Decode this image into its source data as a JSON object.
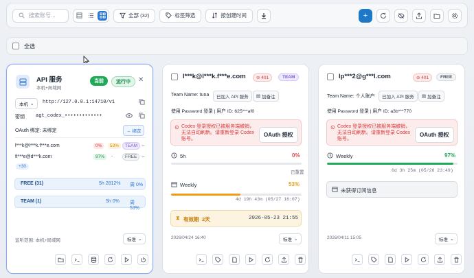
{
  "toolbar": {
    "search_placeholder": "搜索账号...",
    "filter_all": "全部 (32)",
    "tag_filter": "标签筛选",
    "sort_label": "按创建时间"
  },
  "select_all": "全选",
  "api_card": {
    "title": "API 服务",
    "subtitle": "本机+局域网",
    "badge_update": "当前",
    "badge_running": "运行中",
    "host_select": "本机",
    "url": "http://127.0.0.1:14710/v1",
    "key_label": "密钥",
    "key_value": "agt_codex_•••••••••••••",
    "oauth_label": "OAuth 绑定: 未绑定",
    "bind_button": "绑定",
    "accounts": [
      {
        "email": "l***k@l***k.f***e.com",
        "p1": "0%",
        "p2": "53%",
        "tag": "TEAM"
      },
      {
        "email": "fi***e@d***k.com",
        "p1": "97%",
        "p2": "-",
        "tag": "FREE"
      }
    ],
    "more": "+30",
    "groups": [
      {
        "name": "FREE (31)",
        "stat1": "5h 2812%",
        "stat2": "周 0%"
      },
      {
        "name": "TEAM (1)",
        "stat1": "5h 0%",
        "stat2": "周 53%"
      }
    ],
    "listen_label": "监听范围: 本机+局域网",
    "mode": "标准"
  },
  "card2": {
    "email": "l***k@l***k.f***e.com",
    "code": "401",
    "plan": "TEAM",
    "team_name": "Team Name: tuna",
    "join_btn": "已加入 API 服务",
    "note_btn": "加备注",
    "login_info": "使用 Password 登录 | 用户 ID: 625***af0",
    "error_text": "Codex 登录授权已被服务端撤销，无法自动刷新。请重新登录 Codex 账号。",
    "oauth_btn": "OAuth 授权",
    "q1_label": "5h",
    "q1_value": "0%",
    "q1_fill": 0,
    "q1_reset": "已重置",
    "q2_label": "Weekly",
    "q2_value": "53%",
    "q2_fill": 53,
    "q2_reset": "4d 19h 43m (05/27 16:07)",
    "expiry_label": "有效期",
    "expiry_days": "2天",
    "expiry_date": "2026-05-23 21:55",
    "created": "2026/04/24 16:40",
    "mode": "标准"
  },
  "card3": {
    "email": "lp***2@g***l.com",
    "code": "401",
    "plan": "FREE",
    "team_name": "Team Name: 个人账户",
    "join_btn": "已加入 API 服务",
    "note_btn": "加备注",
    "login_info": "使用 Password 登录 | 用户 ID: a3b***770",
    "error_text": "Codex 登录授权已被服务端撤销，无法自动刷新。请重新登录 Codex 账号。",
    "oauth_btn": "OAuth 授权",
    "q1_label": "Weekly",
    "q1_value": "97%",
    "q1_fill": 97,
    "q1_reset": "6d 3h 25m (05/28 23:49)",
    "no_sub": "未获得订阅信息",
    "created": "2026/04/11 15:05",
    "mode": "标准"
  }
}
